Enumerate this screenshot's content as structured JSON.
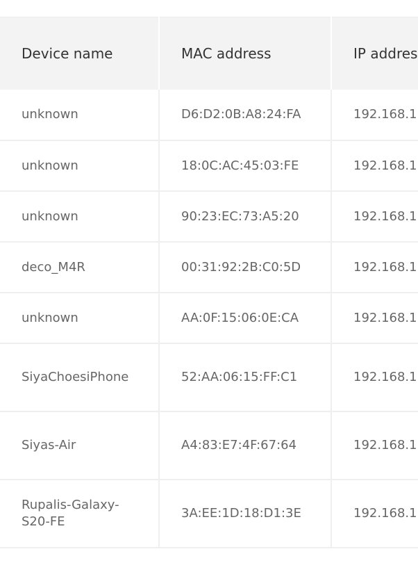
{
  "table": {
    "headers": {
      "device_name": "Device name",
      "mac_address": "MAC address",
      "ip_address": "IP address"
    },
    "rows": [
      {
        "name": "unknown",
        "mac": "D6:D2:0B:A8:24:FA",
        "ip": "192.168.1"
      },
      {
        "name": "unknown",
        "mac": "18:0C:AC:45:03:FE",
        "ip": "192.168.1"
      },
      {
        "name": "unknown",
        "mac": "90:23:EC:73:A5:20",
        "ip": "192.168.1"
      },
      {
        "name": "deco_M4R",
        "mac": "00:31:92:2B:C0:5D",
        "ip": "192.168.1"
      },
      {
        "name": "unknown",
        "mac": "AA:0F:15:06:0E:CA",
        "ip": "192.168.1"
      },
      {
        "name": "SiyaChoesiPhone",
        "mac": "52:AA:06:15:FF:C1",
        "ip": "192.168.1"
      },
      {
        "name": "Siyas-Air",
        "mac": "A4:83:E7:4F:67:64",
        "ip": "192.168.1"
      },
      {
        "name": "Rupalis-Galaxy-S20-FE",
        "mac": "3A:EE:1D:18:D1:3E",
        "ip": "192.168.1"
      }
    ]
  }
}
